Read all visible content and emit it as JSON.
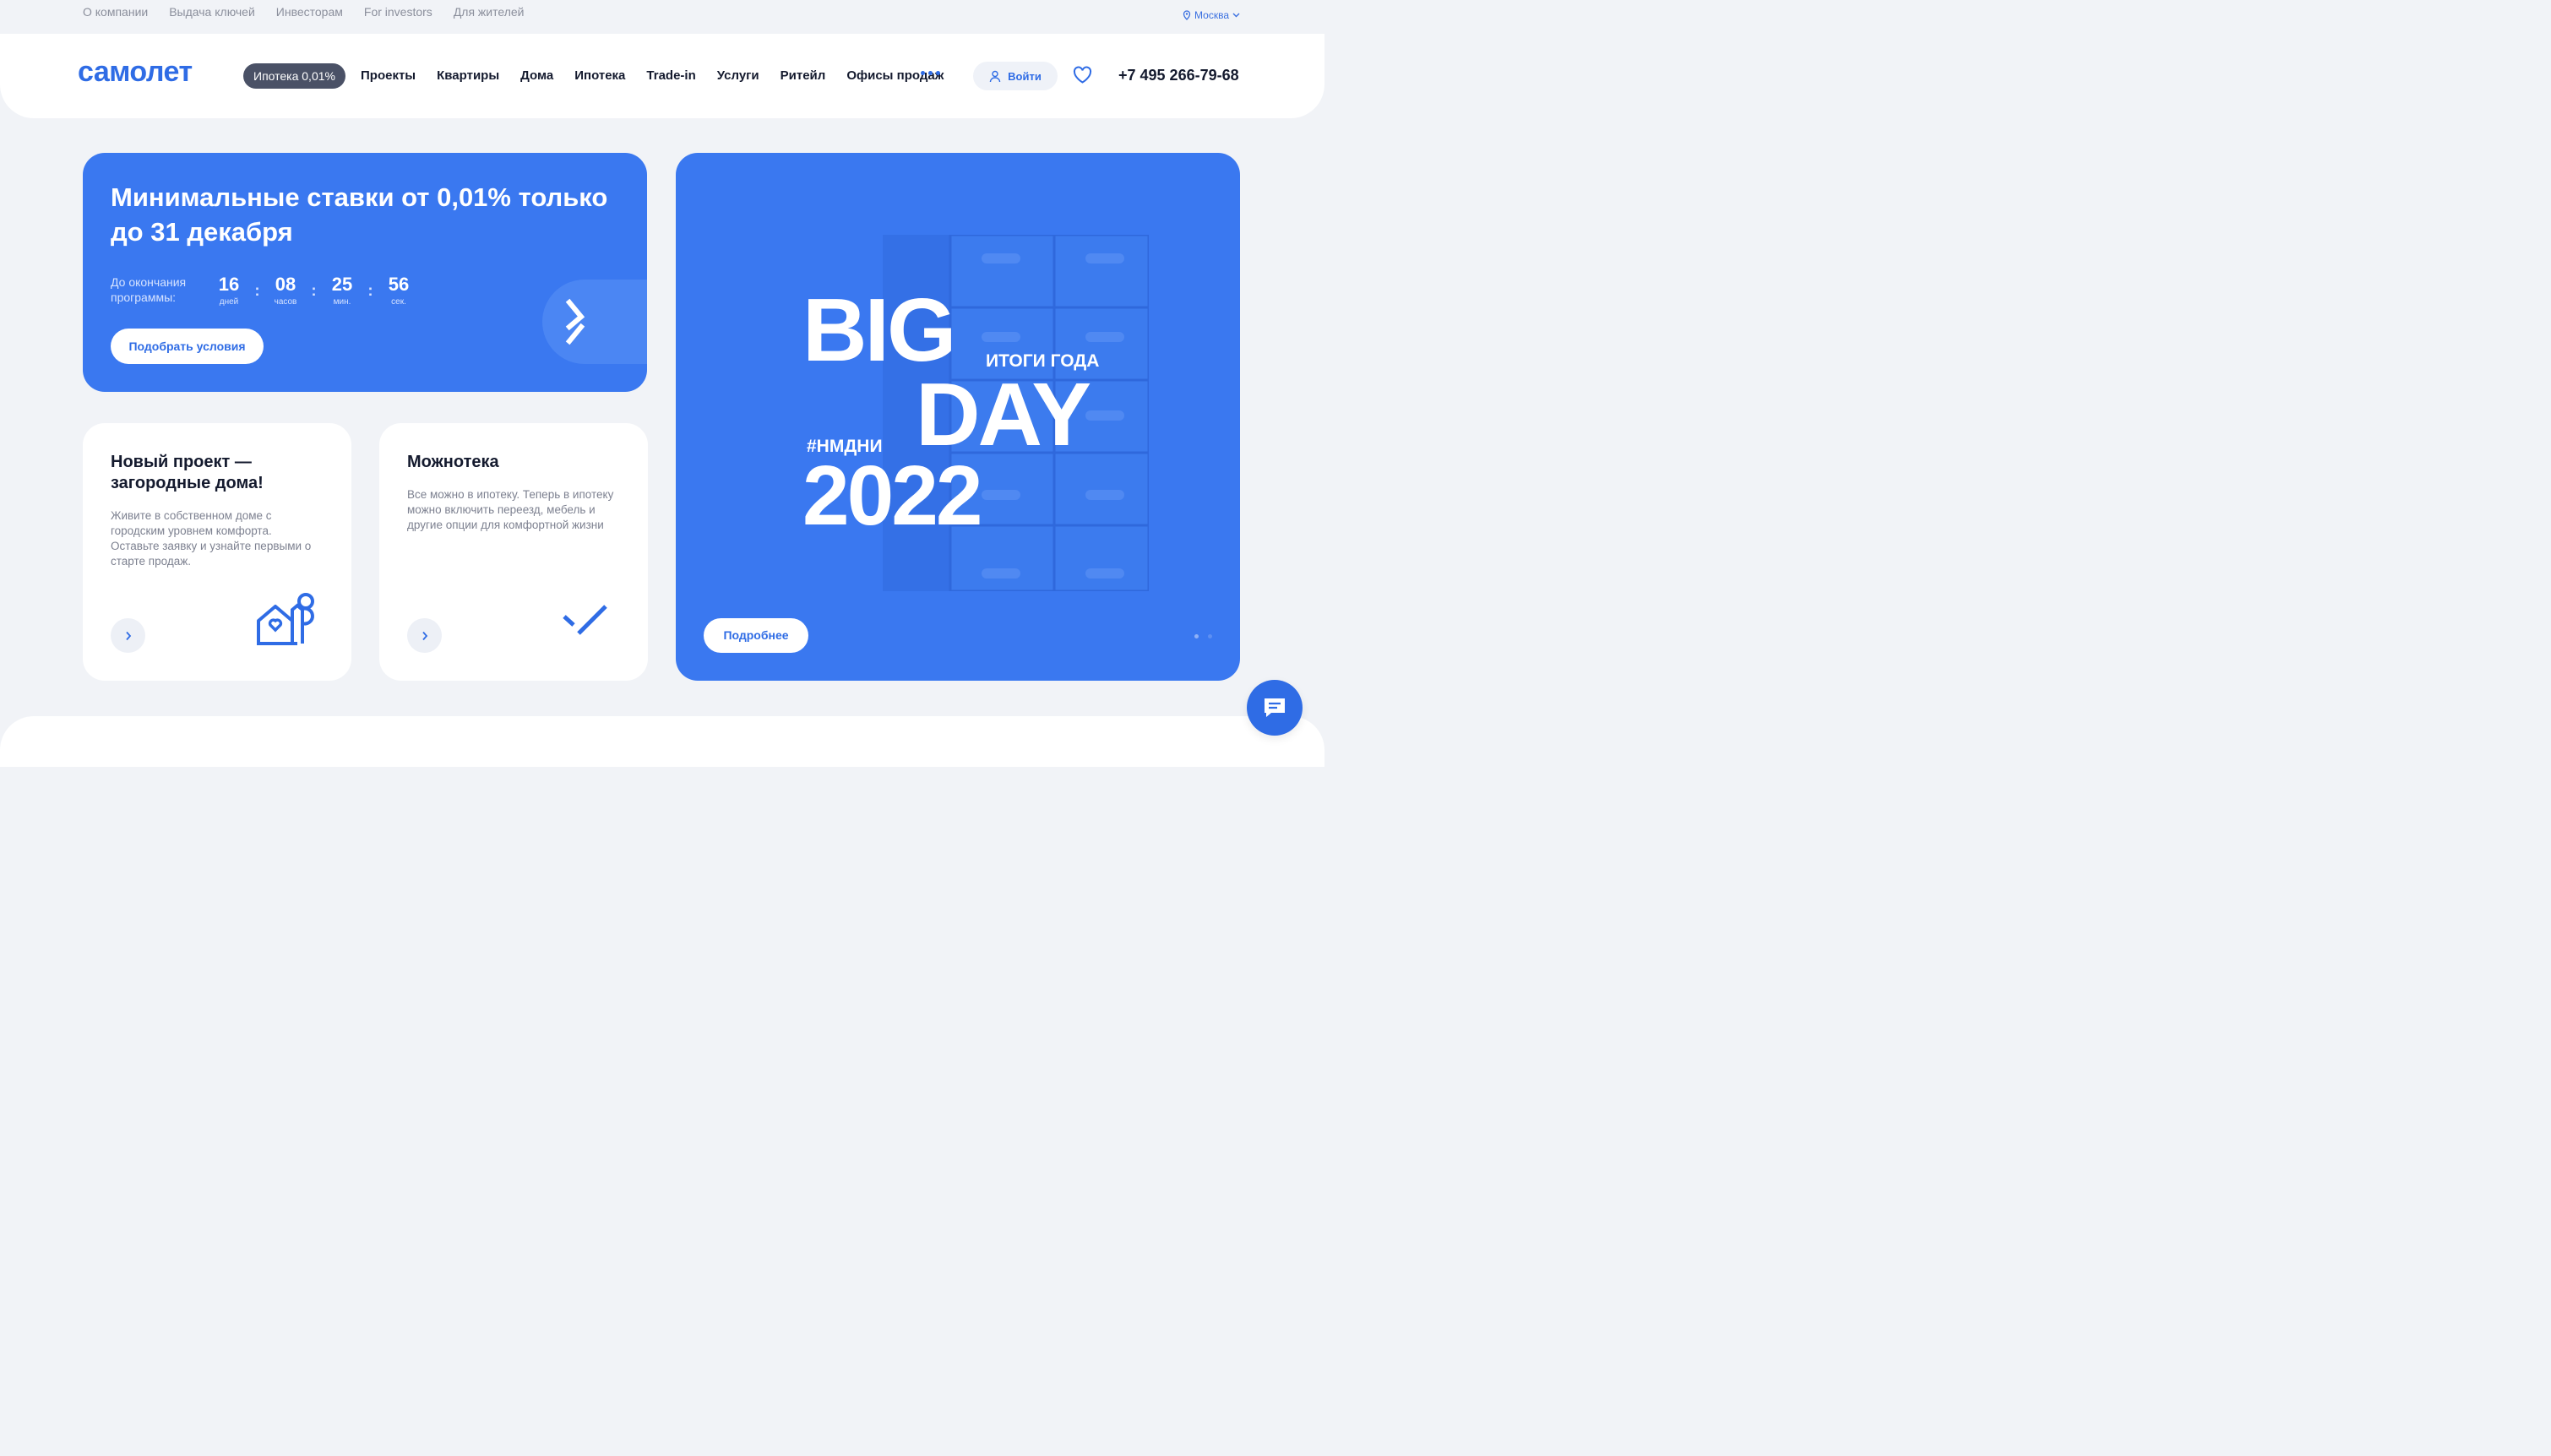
{
  "topbar": {
    "links": [
      "О компании",
      "Выдача ключей",
      "Инвесторам",
      "For investors",
      "Для жителей"
    ],
    "city": "Москва"
  },
  "header": {
    "logo": "самолет",
    "promo_pill": "Ипотека 0,01%",
    "nav": [
      "Проекты",
      "Квартиры",
      "Дома",
      "Ипотека",
      "Trade-in",
      "Услуги",
      "Ритейл",
      "Офисы продаж"
    ],
    "login": "Войти",
    "phone": "+7 495 266-79-68"
  },
  "promo": {
    "title": "Минимальные ставки от 0,01% только до 31 декабря",
    "countdown_label": "До окончания программы:",
    "timer": [
      {
        "value": "16",
        "unit": "дней"
      },
      {
        "value": "08",
        "unit": "часов"
      },
      {
        "value": "25",
        "unit": "мин."
      },
      {
        "value": "56",
        "unit": "сек."
      }
    ],
    "separator": ":",
    "button": "Подобрать условия"
  },
  "cards": [
    {
      "title": "Новый проект — загородные дома!",
      "text": "Живите в собственном доме с городским уровнем комфорта. Оставьте заявку и узнайте первыми о старте продаж."
    },
    {
      "title": "Можнотека",
      "text": "Все можно в ипотеку. Теперь в ипотеку можно включить переезд, мебель и другие опции для комфортной жизни"
    }
  ],
  "banner": {
    "big": "BIG",
    "day": "DAY",
    "year": "2022",
    "subtitle": "ИТОГИ ГОДА",
    "hashtag": "#НМДНИ",
    "button": "Подробнее",
    "slides_total": 2,
    "slide_active": 1
  },
  "colors": {
    "brand_blue": "#2f6ce5",
    "card_blue": "#3a78f0",
    "page_bg": "#f1f3f7"
  }
}
